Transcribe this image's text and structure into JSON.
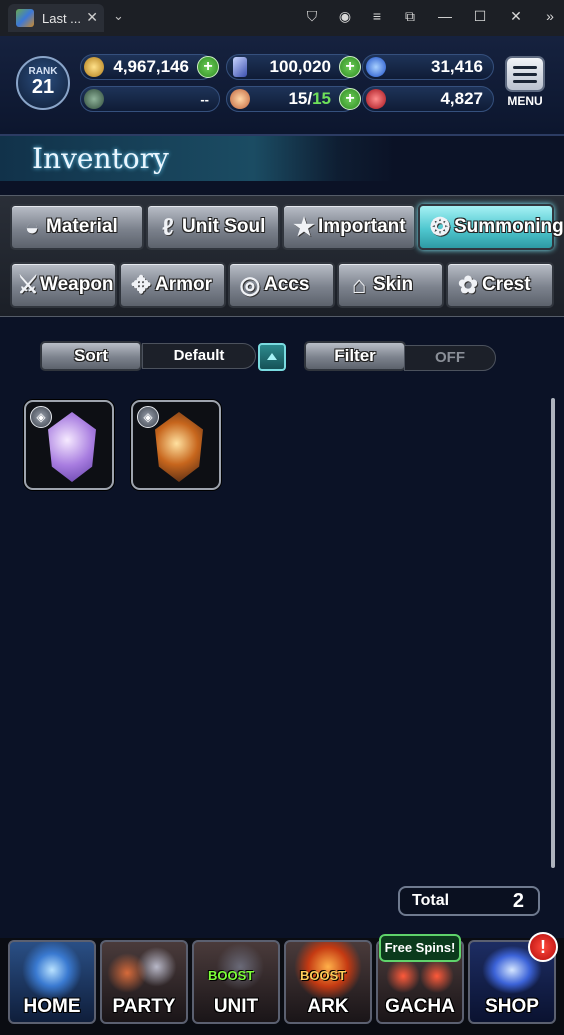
{
  "browser": {
    "tab_title": "Last ...",
    "close_glyph": "✕",
    "chevron_glyph": "⌄",
    "window_icons": [
      "⛉",
      "◉",
      "≡",
      "⧉",
      "—",
      "☐",
      "✕",
      "»"
    ]
  },
  "header": {
    "rank_label": "RANK",
    "rank_value": "21",
    "resources": {
      "gil": "4,967,146",
      "lapis": "100,020",
      "blue_orb": "31,416",
      "green_slot": "--",
      "energy": "15/",
      "energy_max": "15",
      "red_orb": "4,827"
    },
    "menu_label": "MENU"
  },
  "inventory": {
    "title": "Inventory",
    "tabs_row1": [
      "Material",
      "Unit Soul",
      "Important",
      "Summoning"
    ],
    "tabs_row2": [
      "Weapon",
      "Armor",
      "Accs",
      "Skin",
      "Crest"
    ],
    "active_tab": "Summoning",
    "sort_label": "Sort",
    "sort_value": "Default",
    "filter_label": "Filter",
    "filter_value": "OFF",
    "items": [
      {
        "name": "purple-summon-crystal",
        "colors": [
          "#f6eaff",
          "#a87de0",
          "#5b3aa3"
        ]
      },
      {
        "name": "orange-summon-crystal",
        "colors": [
          "#ffe1a0",
          "#c7661d",
          "#3a1d12"
        ]
      }
    ],
    "total_label": "Total",
    "total_value": "2"
  },
  "bottom_nav": {
    "home": "HOME",
    "party": "PARTY",
    "unit": "UNIT",
    "ark": "ARK",
    "gacha": "GACHA",
    "shop": "SHOP",
    "boost": "BOOST",
    "free_spins": "Free Spins!",
    "alert": "!"
  },
  "colors": {
    "accent_cyan": "#4fc7cf",
    "plus_green": "#2e8a22",
    "alert_red": "#b40c0c"
  }
}
